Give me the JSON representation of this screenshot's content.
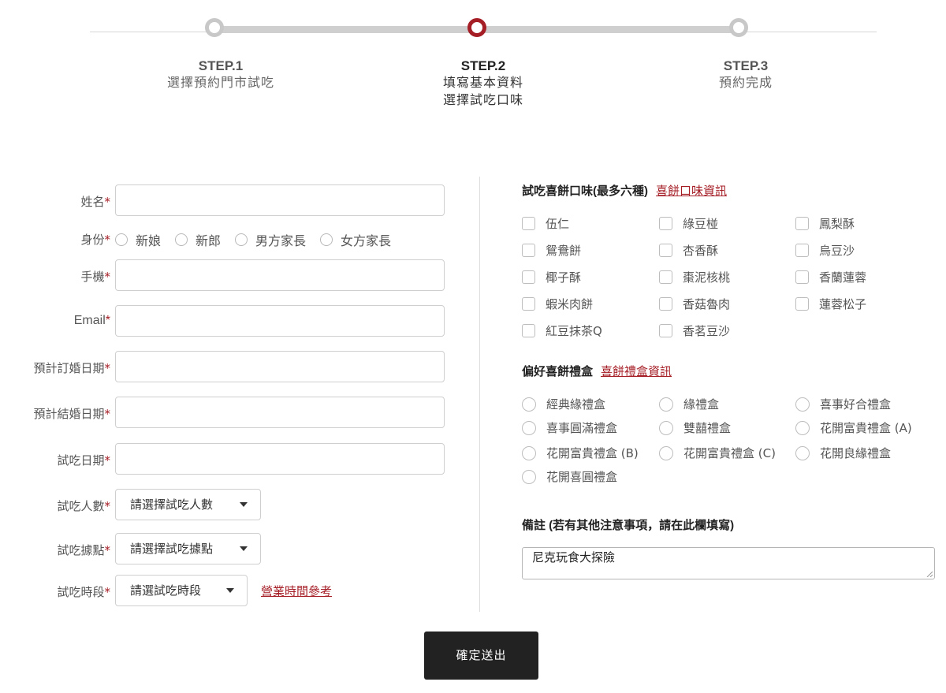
{
  "colors": {
    "accent": "#a51d25",
    "dark_button": "#222222",
    "border": "#cfcfcf"
  },
  "stepper": {
    "current_index": 1,
    "steps": [
      {
        "num": "STEP.1",
        "lines": [
          "選擇預約門市試吃"
        ]
      },
      {
        "num": "STEP.2",
        "lines": [
          "填寫基本資料",
          "選擇試吃口味"
        ]
      },
      {
        "num": "STEP.3",
        "lines": [
          "預約完成"
        ]
      }
    ]
  },
  "form": {
    "required_mark": "*",
    "name_label": "姓名",
    "identity_label": "身份",
    "identity_options": [
      "新娘",
      "新郎",
      "男方家長",
      "女方家長"
    ],
    "phone_label": "手機",
    "email_label": "Email",
    "engagement_date_label": "預計訂婚日期",
    "wedding_date_label": "預計結婚日期",
    "tasting_date_label": "試吃日期",
    "people_label": "試吃人數",
    "people_select": "請選擇試吃人數",
    "location_label": "試吃據點",
    "location_select": "請選擇試吃據點",
    "period_label": "試吃時段",
    "period_select": "請選試吃時段",
    "hours_link": "營業時間參考"
  },
  "flavors": {
    "title": "試吃喜餅口味(最多六種)",
    "info_link": "喜餅口味資訊",
    "options": [
      "伍仁",
      "綠豆椪",
      "鳳梨酥",
      "鴛鴦餅",
      "杏香酥",
      "烏豆沙",
      "椰子酥",
      "棗泥核桃",
      "香蘭蓮蓉",
      "蝦米肉餅",
      "香菇魯肉",
      "蓮蓉松子",
      "紅豆抹茶Q",
      "香茗豆沙"
    ]
  },
  "giftbox": {
    "title": "偏好喜餅禮盒",
    "info_link": "喜餅禮盒資訊",
    "options": [
      "經典緣禮盒",
      "緣禮盒",
      "喜事好合禮盒",
      "喜事圓滿禮盒",
      "雙囍禮盒",
      "花開富貴禮盒 (A)",
      "花開富貴禮盒 (B)",
      "花開富貴禮盒 (C)",
      "花開良緣禮盒",
      "花開喜圓禮盒"
    ]
  },
  "notes": {
    "title": "備註 (若有其他注意事項，請在此欄填寫)",
    "value": "尼克玩食大探險"
  },
  "submit_label": "確定送出"
}
